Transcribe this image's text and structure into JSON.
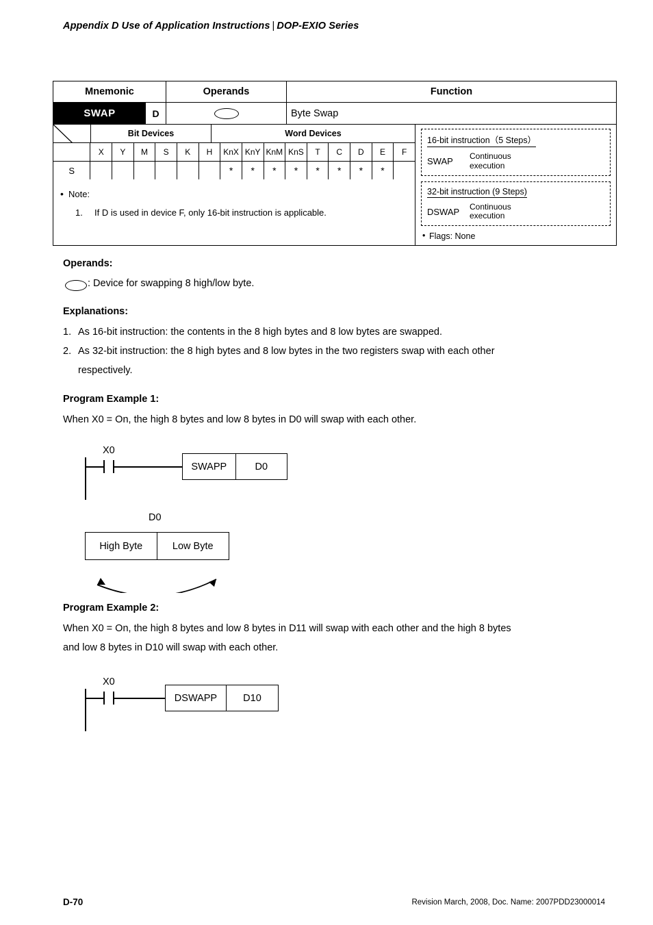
{
  "header": {
    "left": "Appendix D Use of Application Instructions",
    "separator": "|",
    "right": "DOP-EXIO Series"
  },
  "instruction_table": {
    "columns": [
      "Mnemonic",
      "Operands",
      "Function"
    ],
    "mnemonic": "SWAP",
    "operand_letter": "D",
    "operand_symbol": "ellipse-shape",
    "function": "Byte Swap",
    "device_groups": {
      "bit_devices_label": "Bit Devices",
      "word_devices_label": "Word Devices",
      "bit_columns": [
        "X",
        "Y",
        "M",
        "S"
      ],
      "word_columns": [
        "K",
        "H",
        "KnX",
        "KnY",
        "KnM",
        "KnS",
        "T",
        "C",
        "D",
        "E",
        "F"
      ],
      "row_label": "S",
      "row_marks": [
        "",
        "",
        "",
        "",
        "",
        "",
        "*",
        "*",
        "*",
        "*",
        "*",
        "*",
        "*",
        "*"
      ]
    },
    "note": {
      "label": "Note:",
      "items": [
        {
          "num": "1.",
          "text": "If D is used in device F, only 16-bit instruction is applicable."
        }
      ]
    },
    "side_boxes": [
      {
        "title": "16-bit instruction（5 Steps）",
        "name": "SWAP",
        "execution": "Continuous execution"
      },
      {
        "title": "32-bit instruction (9 Steps)",
        "name": "DSWAP",
        "execution": "Continuous execution"
      }
    ],
    "flags": "Flags: None"
  },
  "operands_section": {
    "title": "Operands:",
    "description": ": Device for swapping 8 high/low byte."
  },
  "explanations_section": {
    "title": "Explanations:",
    "items": [
      {
        "num": "1.",
        "text": "As 16-bit instruction: the contents in the 8 high bytes and 8 low bytes are swapped."
      },
      {
        "num": "2.",
        "text": "As 32-bit instruction: the 8 high bytes and 8 low bytes in the two registers swap with each other"
      },
      {
        "num": "",
        "text": "respectively."
      }
    ]
  },
  "example1": {
    "title": "Program Example 1:",
    "description": "When X0 = On, the high 8 bytes and low 8 bytes in D0 will swap with each other.",
    "contact_label": "X0",
    "instruction": "SWAPP",
    "operand": "D0",
    "register_label": "D0",
    "high_byte": "High Byte",
    "low_byte": "Low Byte"
  },
  "example2": {
    "title": "Program Example 2:",
    "description_line1": "When X0 = On, the high 8 bytes and low 8 bytes in D11 will swap with each other and the high 8 bytes",
    "description_line2": "and low 8 bytes in D10 will swap with each other.",
    "contact_label": "X0",
    "instruction": "DSWAPP",
    "operand": "D10"
  },
  "footer": {
    "page": "D-70",
    "revision": "Revision March, 2008, Doc. Name: 2007PDD23000014"
  }
}
